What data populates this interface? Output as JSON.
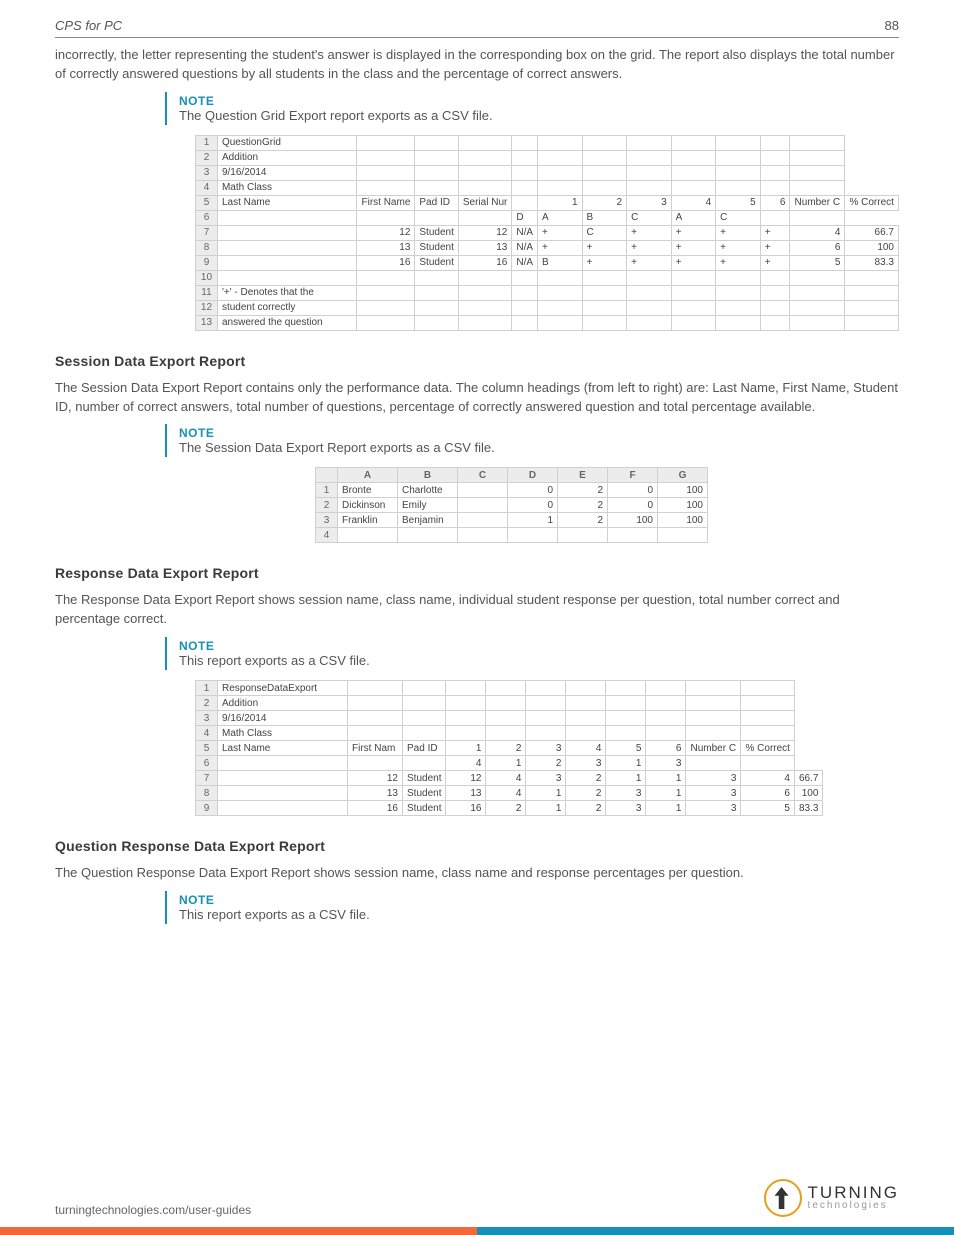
{
  "header": {
    "title": "CPS for PC",
    "page_number": "88"
  },
  "intro_para": "incorrectly, the letter representing the student's answer is displayed in the corresponding box on the grid. The report also displays the total number of correctly answered questions by all students in the class and the percentage of correct answers.",
  "note1": {
    "label": "NOTE",
    "text": "The Question Grid Export report exports as a CSV file."
  },
  "grid1": {
    "rows": [
      [
        "1",
        "QuestionGrid",
        "",
        "",
        "",
        "",
        "",
        "",
        "",
        "",
        "",
        "",
        ""
      ],
      [
        "2",
        "Addition",
        "",
        "",
        "",
        "",
        "",
        "",
        "",
        "",
        "",
        "",
        ""
      ],
      [
        "3",
        "9/16/2014",
        "",
        "",
        "",
        "",
        "",
        "",
        "",
        "",
        "",
        "",
        ""
      ],
      [
        "4",
        "Math Class",
        "",
        "",
        "",
        "",
        "",
        "",
        "",
        "",
        "",
        "",
        ""
      ],
      [
        "5",
        "Last Name",
        "First Name",
        "Pad ID",
        "Serial Nur",
        "",
        "1",
        "2",
        "3",
        "4",
        "5",
        "6",
        "Number C",
        "% Correct"
      ],
      [
        "6",
        "",
        "",
        "",
        "",
        "D",
        "A",
        "B",
        "C",
        "A",
        "C",
        "",
        ""
      ],
      [
        "7",
        "",
        "12",
        "Student",
        "12",
        "N/A",
        "+",
        "C",
        "+",
        "+",
        "+",
        "+",
        "4",
        "66.7"
      ],
      [
        "8",
        "",
        "13",
        "Student",
        "13",
        "N/A",
        "+",
        "+",
        "+",
        "+",
        "+",
        "+",
        "6",
        "100"
      ],
      [
        "9",
        "",
        "16",
        "Student",
        "16",
        "N/A",
        "B",
        "+",
        "+",
        "+",
        "+",
        "+",
        "5",
        "83.3"
      ],
      [
        "10",
        "",
        "",
        "",
        "",
        "",
        "",
        "",
        "",
        "",
        "",
        "",
        "",
        ""
      ],
      [
        "11",
        "'+' - Denotes that the",
        "",
        "",
        "",
        "",
        "",
        "",
        "",
        "",
        "",
        "",
        "",
        ""
      ],
      [
        "12",
        "student correctly",
        "",
        "",
        "",
        "",
        "",
        "",
        "",
        "",
        "",
        "",
        "",
        ""
      ],
      [
        "13",
        "answered the question",
        "",
        "",
        "",
        "",
        "",
        "",
        "",
        "",
        "",
        "",
        "",
        ""
      ]
    ],
    "widths": [
      22,
      140,
      55,
      40,
      45,
      20,
      45,
      45,
      45,
      45,
      45,
      30,
      55,
      48
    ]
  },
  "section2": {
    "heading": "Session Data Export Report",
    "para": "The Session Data Export Report contains only the performance data. The column headings (from left to right) are: Last Name, First Name, Student ID, number of correct answers, total number of questions, percentage of correctly answered question and total percentage available."
  },
  "note2": {
    "label": "NOTE",
    "text": "The Session Data Export Report exports as a CSV file."
  },
  "grid2": {
    "cols": [
      "",
      "A",
      "B",
      "C",
      "D",
      "E",
      "F",
      "G"
    ],
    "rows": [
      [
        "1",
        "Bronte",
        "Charlotte",
        "",
        "0",
        "2",
        "0",
        "100"
      ],
      [
        "2",
        "Dickinson",
        "Emily",
        "",
        "0",
        "2",
        "0",
        "100"
      ],
      [
        "3",
        "Franklin",
        "Benjamin",
        "",
        "1",
        "2",
        "100",
        "100"
      ],
      [
        "4",
        "",
        "",
        "",
        "",
        "",
        "",
        ""
      ]
    ],
    "widths": [
      22,
      60,
      60,
      50,
      50,
      50,
      50,
      50
    ]
  },
  "section3": {
    "heading": "Response Data Export Report",
    "para": "The Response Data Export Report shows session name, class name, individual student response per question, total number correct and percentage correct."
  },
  "note3": {
    "label": "NOTE",
    "text": "This report exports as a CSV file."
  },
  "grid3": {
    "rows": [
      [
        "1",
        "ResponseDataExport",
        "",
        "",
        "",
        "",
        "",
        "",
        "",
        "",
        "",
        ""
      ],
      [
        "2",
        "Addition",
        "",
        "",
        "",
        "",
        "",
        "",
        "",
        "",
        "",
        ""
      ],
      [
        "3",
        "9/16/2014",
        "",
        "",
        "",
        "",
        "",
        "",
        "",
        "",
        "",
        ""
      ],
      [
        "4",
        "Math Class",
        "",
        "",
        "",
        "",
        "",
        "",
        "",
        "",
        "",
        ""
      ],
      [
        "5",
        "Last Name",
        "First Nam",
        "Pad ID",
        "1",
        "2",
        "3",
        "4",
        "5",
        "6",
        "Number C",
        "% Correct"
      ],
      [
        "6",
        "",
        "",
        "",
        "4",
        "1",
        "2",
        "3",
        "1",
        "3",
        "",
        ""
      ],
      [
        "7",
        "",
        "12",
        "Student",
        "12",
        "4",
        "3",
        "2",
        "1",
        "1",
        "3",
        "4",
        "66.7"
      ],
      [
        "8",
        "",
        "13",
        "Student",
        "13",
        "4",
        "1",
        "2",
        "3",
        "1",
        "3",
        "6",
        "100"
      ],
      [
        "9",
        "",
        "16",
        "Student",
        "16",
        "2",
        "1",
        "2",
        "3",
        "1",
        "3",
        "5",
        "83.3"
      ]
    ],
    "widths": [
      22,
      130,
      55,
      40,
      40,
      40,
      40,
      40,
      40,
      40,
      55,
      50
    ]
  },
  "section4": {
    "heading": "Question Response Data Export Report",
    "para": "The Question Response Data Export Report shows session name, class name and response percentages per question."
  },
  "note4": {
    "label": "NOTE",
    "text": "This report exports as a CSV file."
  },
  "footer": {
    "url": "turningtechnologies.com/user-guides",
    "logo_line1": "TURNING",
    "logo_line2": "technologies"
  }
}
